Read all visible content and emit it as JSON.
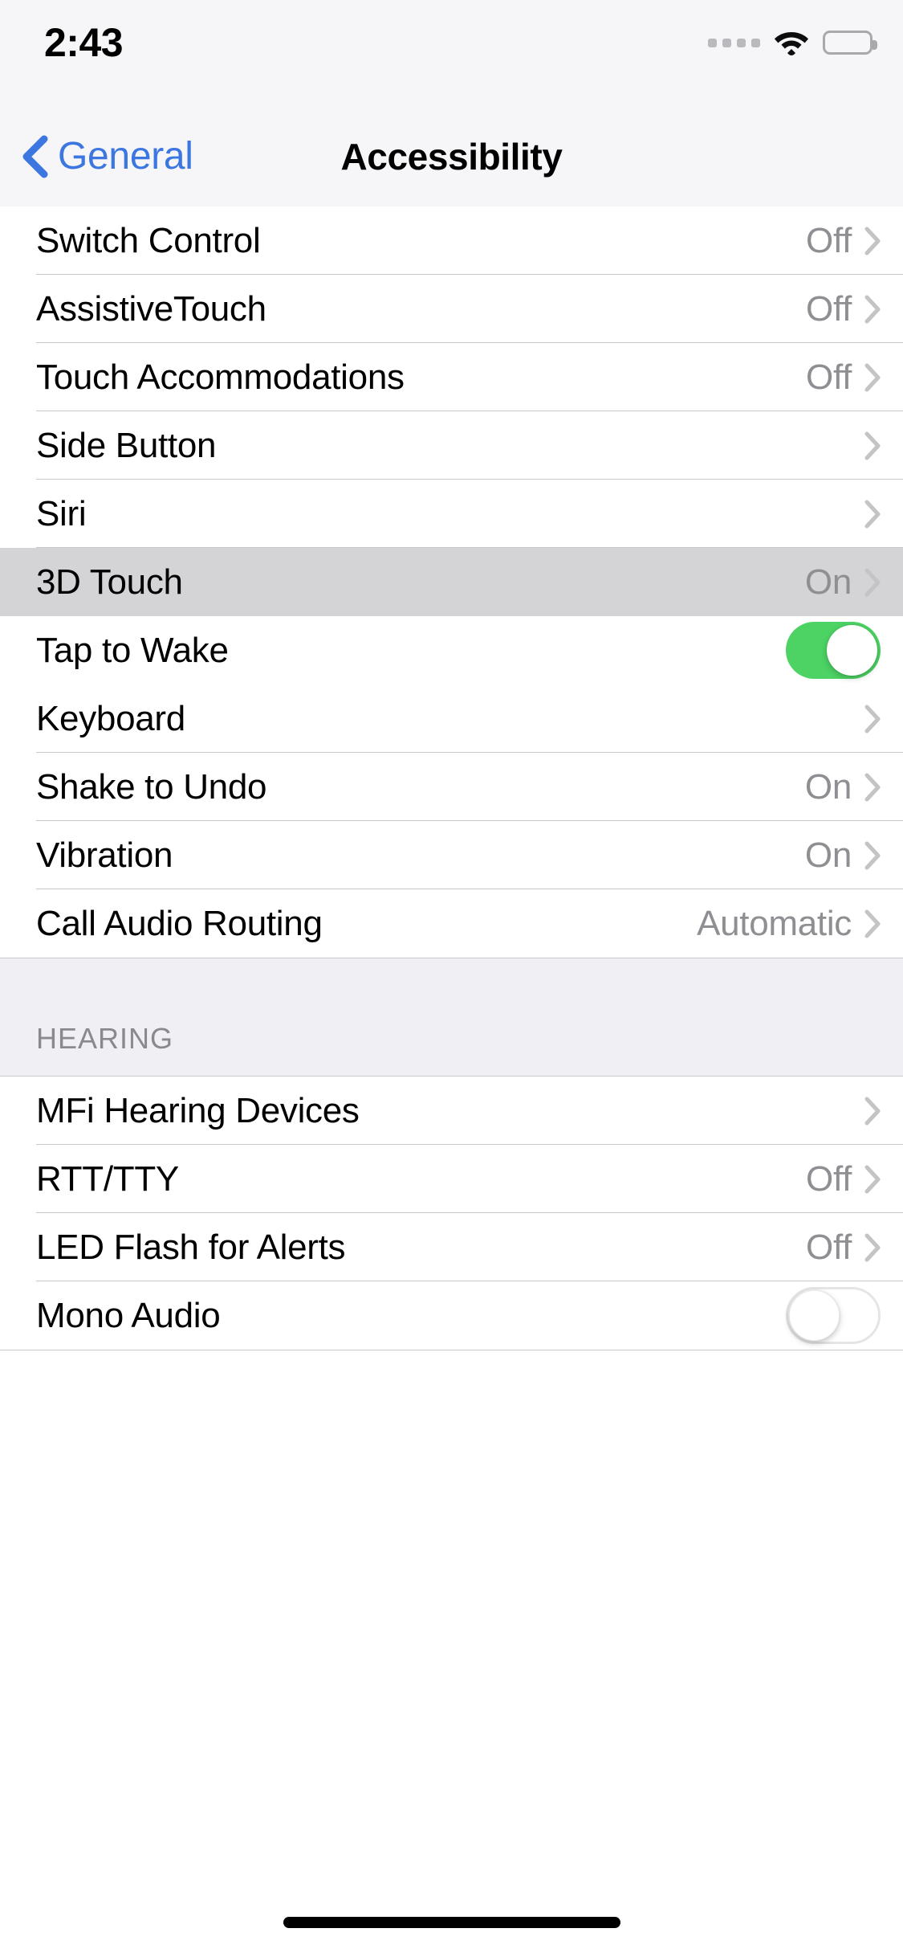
{
  "status_bar": {
    "time": "2:43",
    "icons": {
      "signal": "signal-dots-icon",
      "wifi": "wifi-icon",
      "battery": "battery-full-icon"
    }
  },
  "nav": {
    "back_label": "General",
    "back_icon": "chevron-left-icon",
    "title": "Accessibility"
  },
  "sections": [
    {
      "header": "",
      "rows": [
        {
          "label": "Switch Control",
          "value": "Off",
          "accessory": "chevron",
          "selected": false
        },
        {
          "label": "AssistiveTouch",
          "value": "Off",
          "accessory": "chevron",
          "selected": false
        },
        {
          "label": "Touch Accommodations",
          "value": "Off",
          "accessory": "chevron",
          "selected": false
        },
        {
          "label": "Side Button",
          "value": "",
          "accessory": "chevron",
          "selected": false
        },
        {
          "label": "Siri",
          "value": "",
          "accessory": "chevron",
          "selected": false
        },
        {
          "label": "3D Touch",
          "value": "On",
          "accessory": "chevron",
          "selected": true
        },
        {
          "label": "Tap to Wake",
          "value": "",
          "accessory": "switch-on",
          "selected": false
        },
        {
          "label": "Keyboard",
          "value": "",
          "accessory": "chevron",
          "selected": false
        },
        {
          "label": "Shake to Undo",
          "value": "On",
          "accessory": "chevron",
          "selected": false
        },
        {
          "label": "Vibration",
          "value": "On",
          "accessory": "chevron",
          "selected": false
        },
        {
          "label": "Call Audio Routing",
          "value": "Automatic",
          "accessory": "chevron",
          "selected": false
        }
      ]
    },
    {
      "header": "HEARING",
      "rows": [
        {
          "label": "MFi Hearing Devices",
          "value": "",
          "accessory": "chevron",
          "selected": false
        },
        {
          "label": "RTT/TTY",
          "value": "Off",
          "accessory": "chevron",
          "selected": false
        },
        {
          "label": "LED Flash for Alerts",
          "value": "Off",
          "accessory": "chevron",
          "selected": false
        },
        {
          "label": "Mono Audio",
          "value": "",
          "accessory": "switch-off",
          "selected": false
        }
      ]
    }
  ],
  "colors": {
    "accent_blue": "#3c76e0",
    "switch_on_green": "#4cd364",
    "value_gray": "#8e8e93",
    "separator": "#c8c7cc",
    "group_background": "#efeff4",
    "selected_row": "#d4d4d6",
    "bar_background": "#f6f6f8"
  },
  "home_indicator": "home-indicator"
}
